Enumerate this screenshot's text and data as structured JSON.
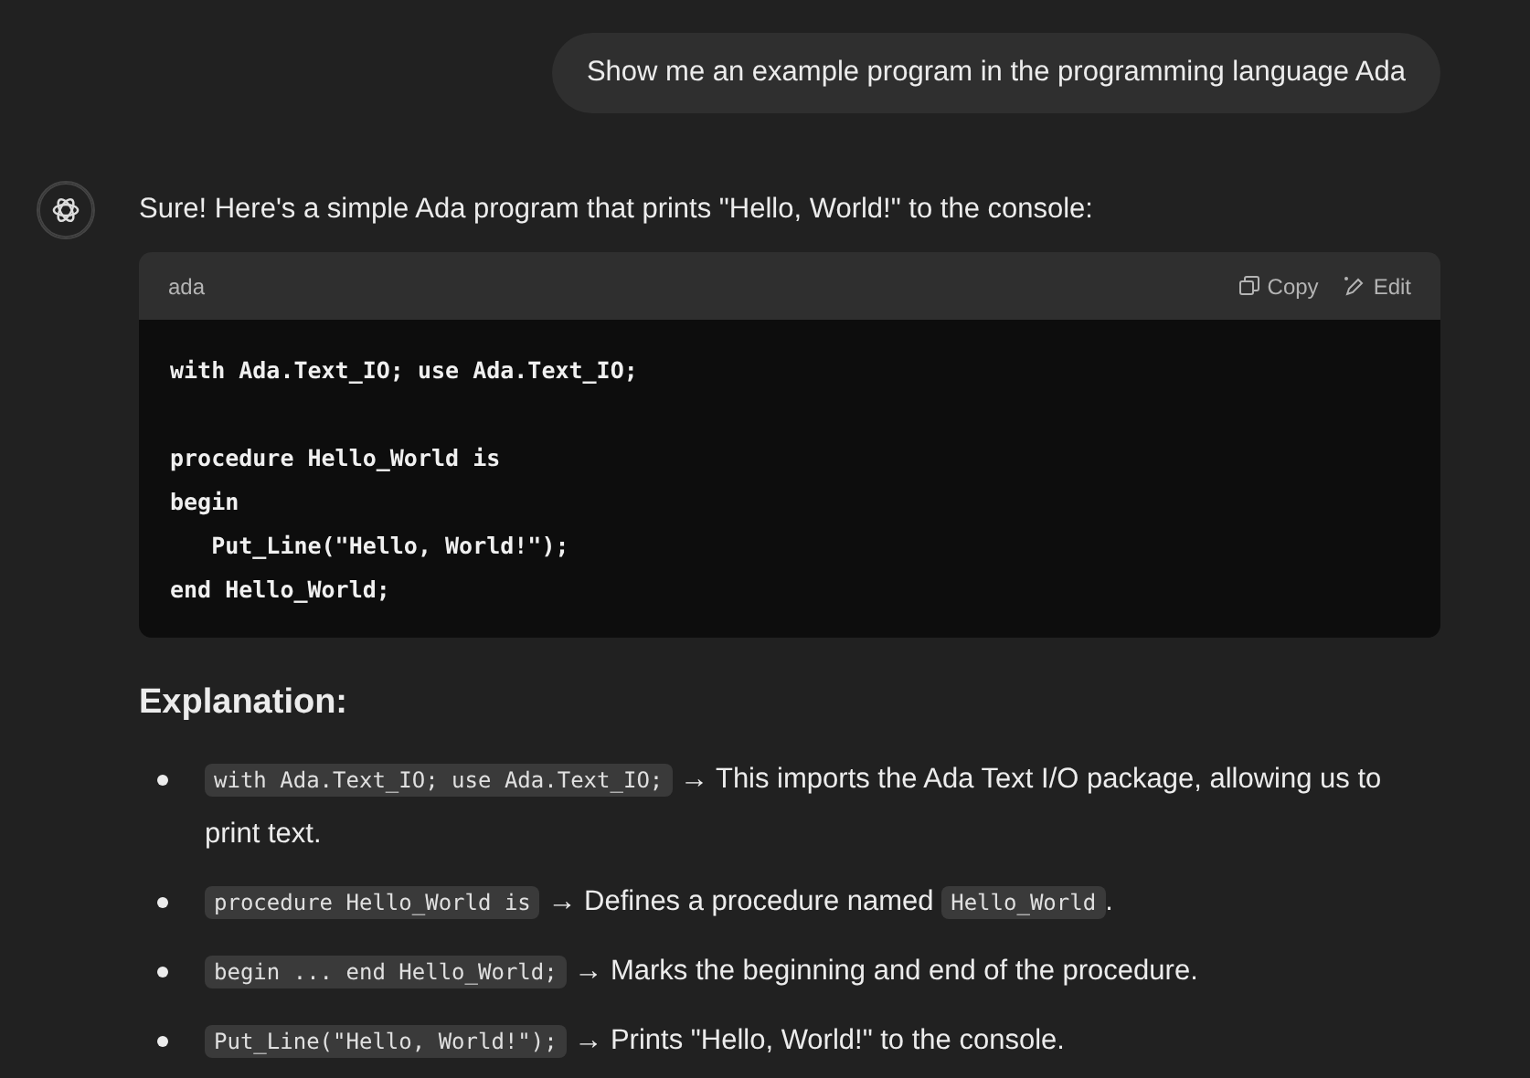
{
  "user_message": {
    "text": "Show me an example program in the programming language Ada"
  },
  "assistant": {
    "intro": "Sure! Here's a simple Ada program that prints \"Hello, World!\" to the console:",
    "code_block": {
      "language": "ada",
      "copy_label": "Copy",
      "edit_label": "Edit",
      "code": "with Ada.Text_IO; use Ada.Text_IO;\n\nprocedure Hello_World is\nbegin\n   Put_Line(\"Hello, World!\");\nend Hello_World;"
    },
    "heading": "Explanation:",
    "bullets": [
      {
        "segments": [
          {
            "kind": "code",
            "text": "with Ada.Text_IO; use Ada.Text_IO;"
          },
          {
            "kind": "text",
            "text": " → This imports the Ada Text I/O package, allowing us to print text."
          }
        ]
      },
      {
        "segments": [
          {
            "kind": "code",
            "text": "procedure Hello_World is"
          },
          {
            "kind": "text",
            "text": " → Defines a procedure named "
          },
          {
            "kind": "code",
            "text": "Hello_World"
          },
          {
            "kind": "text",
            "text": "."
          }
        ]
      },
      {
        "segments": [
          {
            "kind": "code",
            "text": "begin ... end Hello_World;"
          },
          {
            "kind": "text",
            "text": " → Marks the beginning and end of the procedure."
          }
        ]
      },
      {
        "segments": [
          {
            "kind": "code",
            "text": "Put_Line(\"Hello, World!\");"
          },
          {
            "kind": "text",
            "text": " → Prints \"Hello, World!\" to the console."
          }
        ]
      }
    ]
  }
}
